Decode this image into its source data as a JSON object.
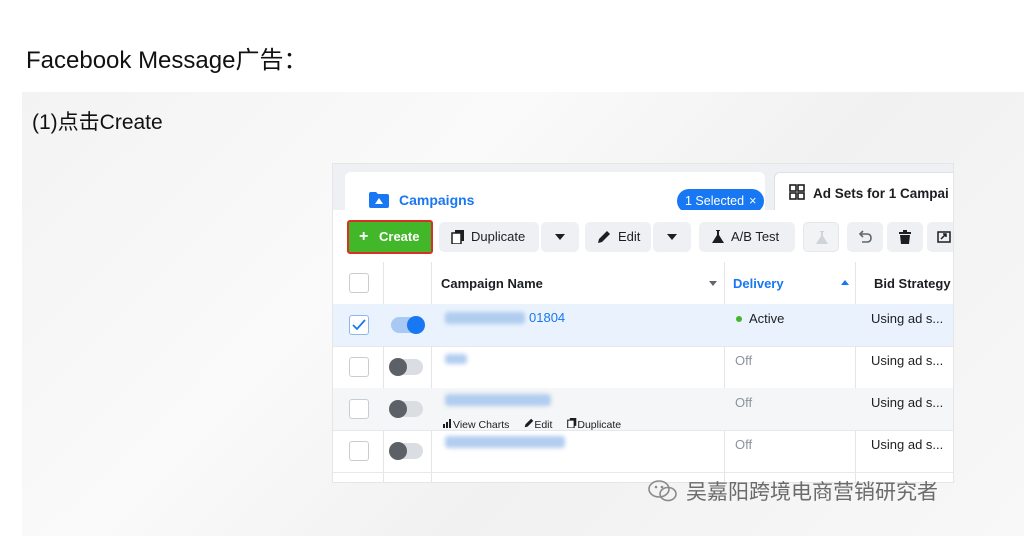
{
  "heading": "Facebook Message广告：",
  "step": "(1)点击Create",
  "tabs": {
    "campaigns_label": "Campaigns",
    "selected_pill": "1 Selected",
    "selected_close": "×",
    "adsets_label": "Ad Sets for 1 Campai"
  },
  "toolbar": {
    "create_label": "Create",
    "duplicate_label": "Duplicate",
    "edit_label": "Edit",
    "ab_test_label": "A/B Test"
  },
  "table": {
    "headers": {
      "name": "Campaign Name",
      "delivery": "Delivery",
      "bid": "Bid Strategy"
    },
    "rows": [
      {
        "name_suffix": "01804",
        "delivery": "Active",
        "bid": "Using ad s...",
        "toggle_on": true,
        "checked": true
      },
      {
        "name_suffix": "",
        "delivery": "Off",
        "bid": "Using ad s...",
        "toggle_on": false,
        "checked": false
      },
      {
        "name_suffix": "",
        "delivery": "Off",
        "bid": "Using ad s...",
        "toggle_on": false,
        "checked": false
      },
      {
        "name_suffix": "",
        "delivery": "Off",
        "bid": "Using ad s...",
        "toggle_on": false,
        "checked": false
      }
    ],
    "row_actions": {
      "view_charts": "View Charts",
      "edit": "Edit",
      "duplicate": "Duplicate"
    }
  },
  "watermark": "吴嘉阳跨境电商营销研究者",
  "colors": {
    "accent": "#1877f2",
    "create_green": "#42b72a",
    "highlight_red": "#d93025",
    "active_green": "#42b72a"
  }
}
